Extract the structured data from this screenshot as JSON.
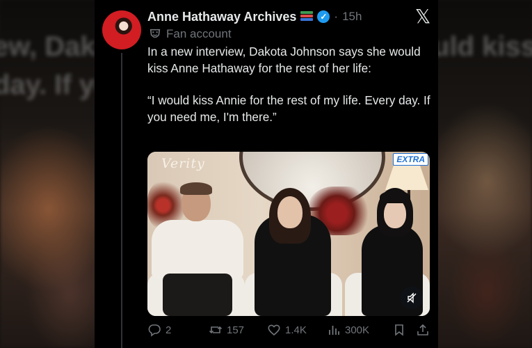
{
  "account": {
    "name": "Anne Hathaway Archives",
    "time": "15h",
    "separator": "·",
    "label": "Fan account",
    "verified_icon": "check-icon",
    "emoji_icon": "books-icon"
  },
  "tweet": {
    "paragraph1": "In a new interview, Dakota Johnson says she would kiss Anne Hathaway for the rest of her life:",
    "paragraph2": "“I would kiss Annie for the rest of my life. Every day. If you need me, I'm there.”"
  },
  "media": {
    "watermark_left": "Verity",
    "watermark_right": "EXTRA"
  },
  "actions": {
    "replies": "2",
    "reposts": "157",
    "likes": "1.4K",
    "views": "300K"
  },
  "background_text": {
    "line1": "ew, Dakota Johnson says she would kiss Anne Hathaway for the rest of my life",
    "line2": "day. If you need me, I'm there."
  },
  "colors": {
    "card_bg": "#000000",
    "text": "#e7e9ea",
    "muted": "#71767b",
    "verified": "#1d9bf0",
    "avatar": "#d21d23"
  }
}
